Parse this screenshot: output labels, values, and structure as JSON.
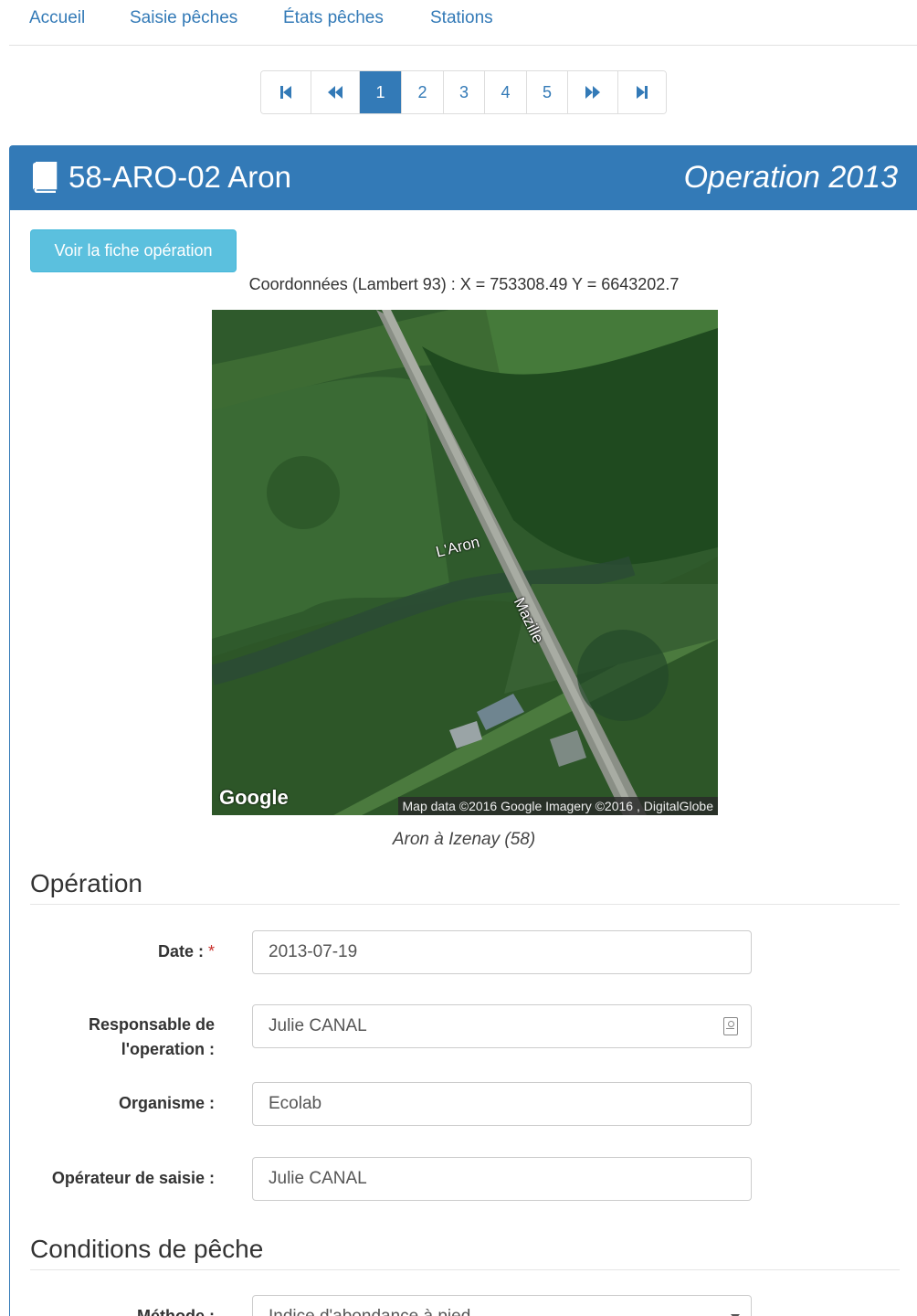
{
  "nav": {
    "items": [
      {
        "label": "Accueil"
      },
      {
        "label": "Saisie pêches"
      },
      {
        "label": "États pêches"
      },
      {
        "label": "Stations"
      }
    ]
  },
  "pagination": {
    "first_icon": "step-backward-icon",
    "prev_icon": "fast-backward-icon",
    "pages": [
      "1",
      "2",
      "3",
      "4",
      "5"
    ],
    "active_page": "1",
    "next_icon": "fast-forward-icon",
    "last_icon": "step-forward-icon"
  },
  "header": {
    "icon": "book-icon",
    "station": "58-ARO-02 Aron",
    "operation": "Operation 2013",
    "color": "#337ab7"
  },
  "fiche_button": {
    "label": "Voir la fiche opération",
    "color": "#5bc0de"
  },
  "coordinates": "Coordonnées (Lambert 93) : X = 753308.49 Y = 6643202.7",
  "map": {
    "logo": "Google",
    "attribution": "Map data ©2016 Google  Imagery ©2016 , DigitalGlobe",
    "river_label": "L'Aron",
    "road_label": "Mazille"
  },
  "caption": "Aron à Izenay (58)",
  "operation_section": {
    "title": "Opération",
    "date_label": "Date :",
    "date_required": "*",
    "date_value": "2013-07-19",
    "responsable_label_1": "Responsable de",
    "responsable_label_2": "l'operation :",
    "responsable_value": "Julie CANAL",
    "responsable_icon": "contact-card-icon",
    "organisme_label": "Organisme :",
    "organisme_value": "Ecolab",
    "operateur_label": "Opérateur de saisie :",
    "operateur_value": "Julie CANAL"
  },
  "conditions_section": {
    "title": "Conditions de pêche",
    "methode_label": "Méthode :",
    "methode_value": "Indice d'abondance à pied"
  }
}
